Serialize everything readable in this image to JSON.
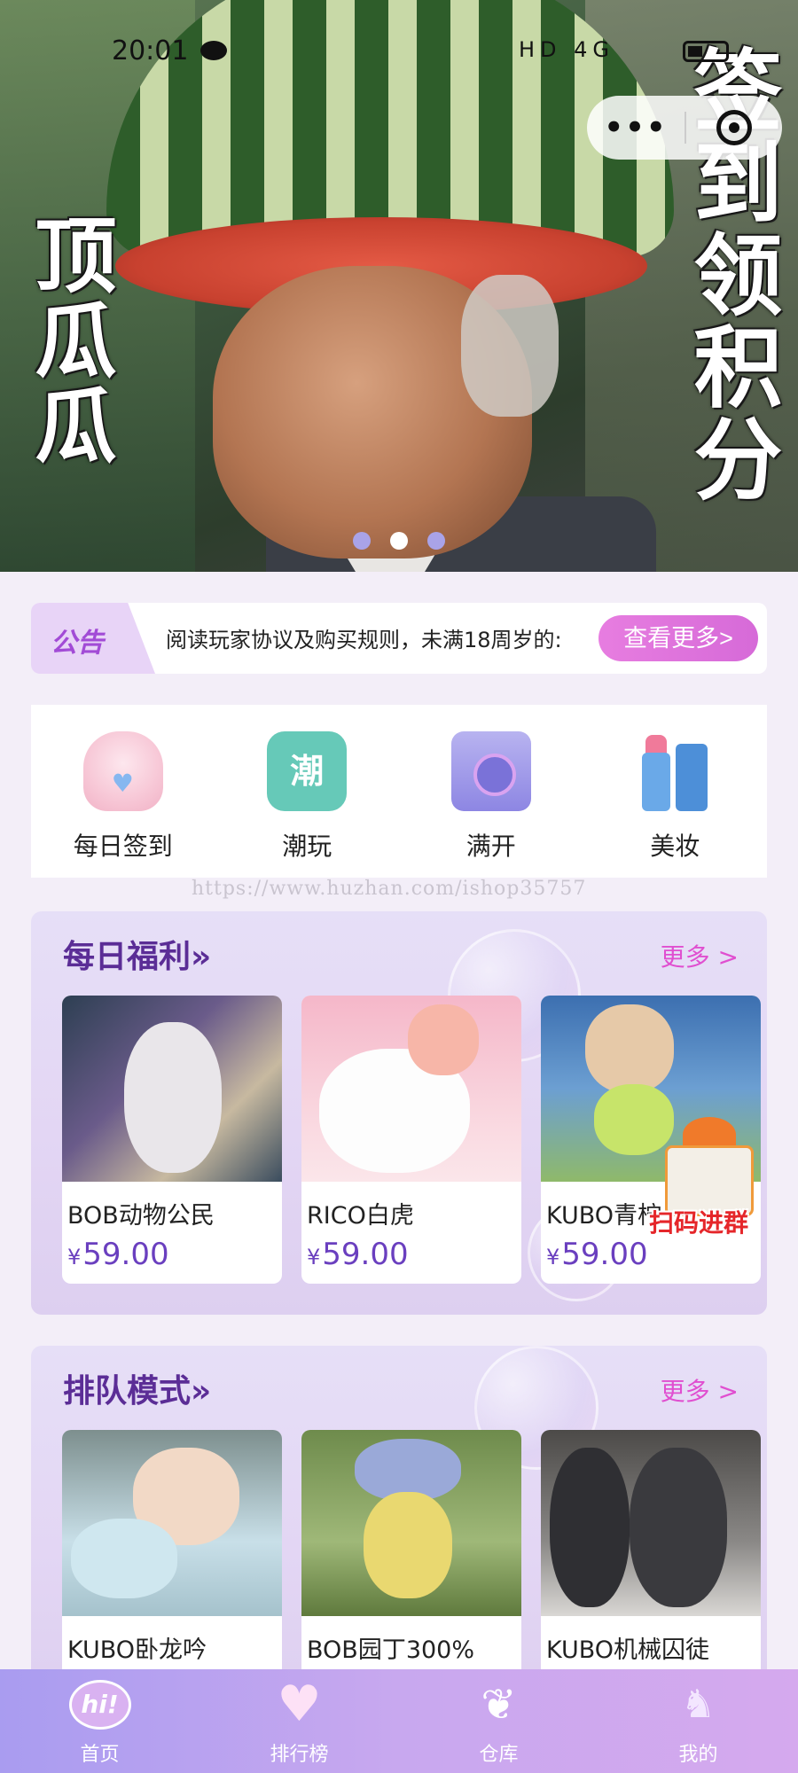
{
  "status_bar": {
    "time": "20:01",
    "indicators": "HD 4G"
  },
  "hero": {
    "left_text": "顶瓜瓜",
    "right_text": "签到领积分",
    "active_slide": 2,
    "slide_count": 3
  },
  "capsule": {
    "more": "•••"
  },
  "notice": {
    "tag": "公告",
    "text": "阅读玩家协议及购买规则，未满18周岁的:",
    "button": "查看更多>"
  },
  "quick_nav": [
    {
      "label": "每日签到",
      "icon": "ghost-heart-icon"
    },
    {
      "label": "潮玩",
      "icon": "chao-badge-icon",
      "icon_text": "潮"
    },
    {
      "label": "满开",
      "icon": "camera-icon"
    },
    {
      "label": "美妆",
      "icon": "lipstick-icon"
    }
  ],
  "watermark": "https://www.huzhan.com/ishop35757",
  "daily_welfare": {
    "title": "每日福利»",
    "more": "更多 >",
    "items": [
      {
        "name": "BOB动物公民",
        "currency": "¥",
        "price": "59.00"
      },
      {
        "name": "RICO白虎",
        "currency": "¥",
        "price": "59.00"
      },
      {
        "name": "KUBO青柠",
        "currency": "¥",
        "price": "59.00"
      }
    ]
  },
  "gift_badge": {
    "text": "扫码进群"
  },
  "queue_mode": {
    "title": "排队模式»",
    "more": "更多 >",
    "items": [
      {
        "name": "KUBO卧龙吟"
      },
      {
        "name": "BOB园丁300%"
      },
      {
        "name": "KUBO机械囚徒"
      }
    ]
  },
  "tab_bar": [
    {
      "label": "首页",
      "icon": "hi-bubble-icon",
      "icon_text": "hi!"
    },
    {
      "label": "排行榜",
      "icon": "heart-icon"
    },
    {
      "label": "仓库",
      "icon": "wings-icon"
    },
    {
      "label": "我的",
      "icon": "unicorn-icon"
    }
  ],
  "colors": {
    "accent": "#e04fd0",
    "title": "#5b2d96",
    "price": "#6a3fbf"
  }
}
